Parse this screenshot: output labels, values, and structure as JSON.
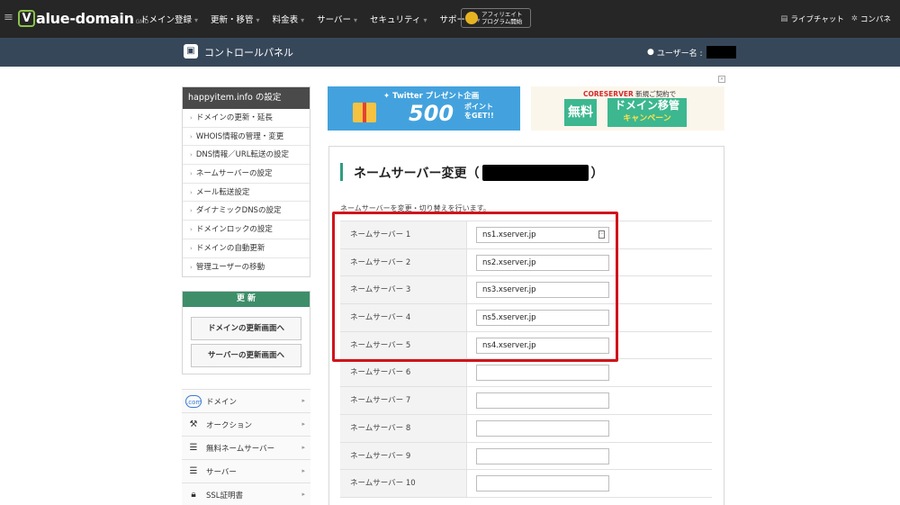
{
  "nav": {
    "menu_icon": "hamburger-icon",
    "logo_text": "alue-domain",
    "logo_mark": "V",
    "logo_sub": "GMO",
    "items": [
      {
        "label": "ドメイン登録"
      },
      {
        "label": "更新・移管"
      },
      {
        "label": "料金表"
      },
      {
        "label": "サーバー"
      },
      {
        "label": "セキュリティ"
      },
      {
        "label": "サポート"
      }
    ],
    "affiliate_line1": "アフィリエイト",
    "affiliate_line2": "プログラム開始",
    "live_chat": "ライブチャット",
    "control_panel": "コンパネ"
  },
  "subheader": {
    "title": "コントロールパネル",
    "user_label": "ユーザー名 :"
  },
  "domain_menu": {
    "title": "happyitem.info の設定",
    "items": [
      {
        "label": "ドメインの更新・延長"
      },
      {
        "label": "WHOIS情報の管理・変更"
      },
      {
        "label": "DNS情報／URL転送の設定"
      },
      {
        "label": "ネームサーバーの設定"
      },
      {
        "label": "メール転送設定"
      },
      {
        "label": "ダイナミックDNSの設定"
      },
      {
        "label": "ドメインロックの設定"
      },
      {
        "label": "ドメインの自動更新"
      },
      {
        "label": "管理ユーザーの移動"
      }
    ]
  },
  "renew": {
    "title": "更 新",
    "domain_button": "ドメインの更新画面へ",
    "server_button": "サーバーの更新画面へ"
  },
  "side_menu": {
    "items": [
      {
        "label": "ドメイン",
        "icon": ".com"
      },
      {
        "label": "オークション",
        "icon": "gavel"
      },
      {
        "label": "無料ネームサーバー",
        "icon": "server"
      },
      {
        "label": "サーバー",
        "icon": "server"
      },
      {
        "label": "SSL証明書",
        "icon": "lock"
      }
    ]
  },
  "banner1": {
    "headline": "Twitter プレゼント企画",
    "amount": "500",
    "unit_line1": "ポイント",
    "unit_line2": "をGET!!"
  },
  "banner2": {
    "brand": "CORESERVER",
    "headline": " 新規ご契約で",
    "free": "無料",
    "move_line1": "ドメイン移管",
    "move_line2": "キャンペーン"
  },
  "main": {
    "heading_left": "ネームサーバー変更（",
    "heading_right": "）",
    "description": "ネームサーバーを変更・切り替えを行います。",
    "nameservers": [
      {
        "label": "ネームサーバー 1",
        "value": "ns1.xserver.jp"
      },
      {
        "label": "ネームサーバー 2",
        "value": "ns2.xserver.jp"
      },
      {
        "label": "ネームサーバー 3",
        "value": "ns3.xserver.jp"
      },
      {
        "label": "ネームサーバー 4",
        "value": "ns5.xserver.jp"
      },
      {
        "label": "ネームサーバー 5",
        "value": "ns4.xserver.jp"
      },
      {
        "label": "ネームサーバー 6",
        "value": ""
      },
      {
        "label": "ネームサーバー 7",
        "value": ""
      },
      {
        "label": "ネームサーバー 8",
        "value": ""
      },
      {
        "label": "ネームサーバー 9",
        "value": ""
      },
      {
        "label": "ネームサーバー 10",
        "value": ""
      }
    ]
  },
  "colors": {
    "topnav": "#262626",
    "subheader": "#37475a",
    "accent_green": "#3e8e6a",
    "highlight_red": "#d0141b"
  }
}
